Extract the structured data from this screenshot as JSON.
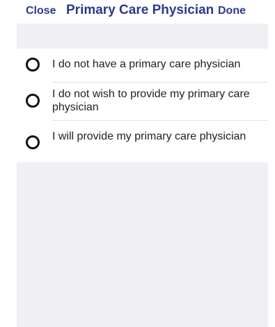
{
  "nav": {
    "close_label": "Close",
    "title": "Primary Care Physician",
    "done_label": "Done"
  },
  "options": [
    {
      "label": "I do not have a primary care physician",
      "selected": false
    },
    {
      "label": "I do not wish to provide my primary care physician",
      "selected": false
    },
    {
      "label": "I will provide my primary care physician",
      "selected": false
    }
  ],
  "colors": {
    "accent": "#2c3a8c",
    "section_background": "#efeff4",
    "radio_stroke": "#111111"
  }
}
